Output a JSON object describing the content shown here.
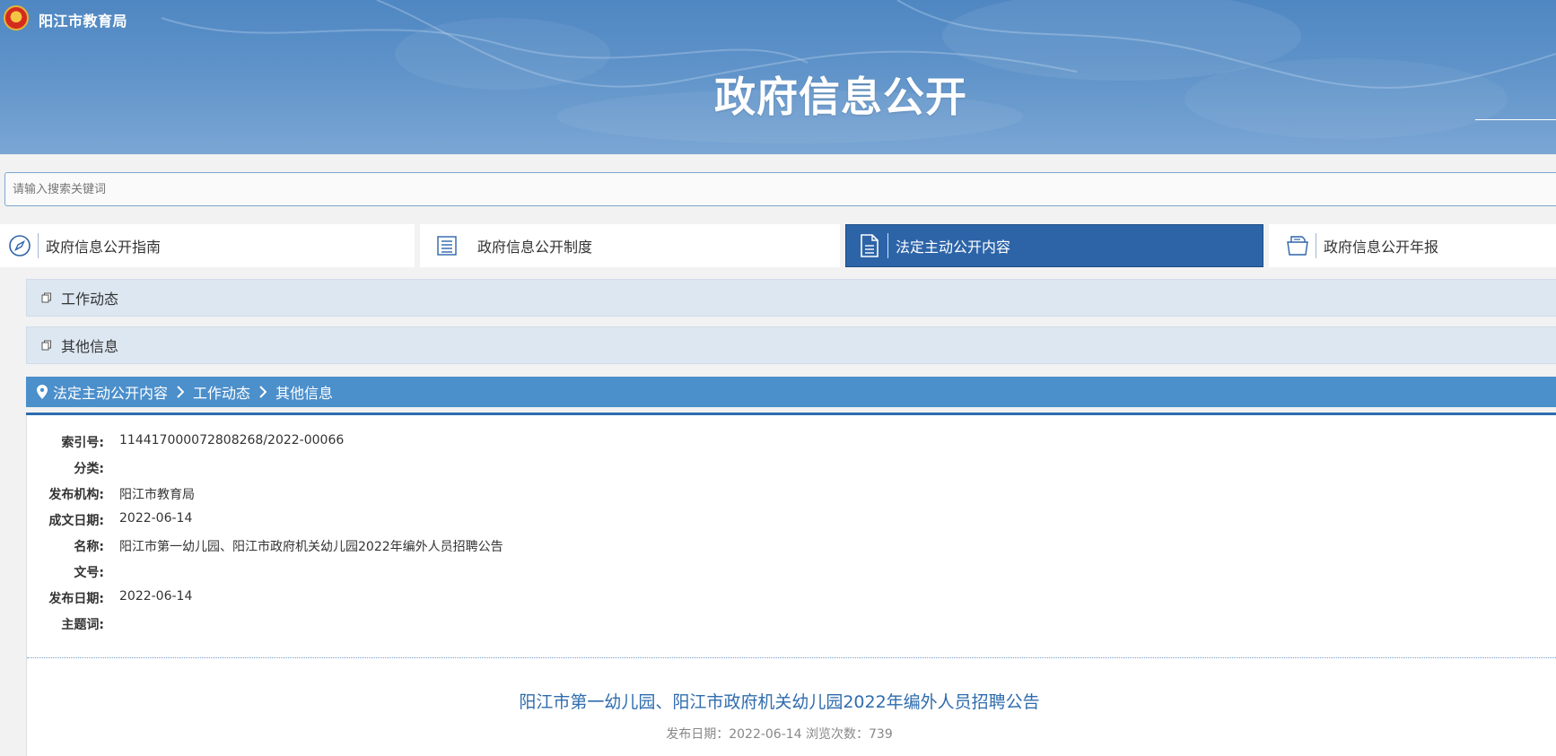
{
  "header": {
    "site_name": "阳江市教育局",
    "page_title": "政府信息公开"
  },
  "search": {
    "placeholder": "请输入搜索关键词"
  },
  "tabs": [
    {
      "label": "政府信息公开指南",
      "icon": "compass-icon",
      "active": false
    },
    {
      "label": "政府信息公开制度",
      "icon": "list-icon",
      "active": false
    },
    {
      "label": "法定主动公开内容",
      "icon": "document-icon",
      "active": true
    },
    {
      "label": "政府信息公开年报",
      "icon": "folder-icon",
      "active": false
    }
  ],
  "categories": [
    {
      "label": "工作动态",
      "icon": "copy-doc-icon"
    },
    {
      "label": "其他信息",
      "icon": "copy-doc-icon"
    }
  ],
  "breadcrumb": {
    "icon": "location-pin-icon",
    "items": [
      "法定主动公开内容",
      "工作动态",
      "其他信息"
    ]
  },
  "meta": [
    {
      "label": "索引号:",
      "value": "114417000072808268/2022-00066"
    },
    {
      "label": "分类:",
      "value": ""
    },
    {
      "label": "发布机构:",
      "value": "阳江市教育局"
    },
    {
      "label": "成文日期:",
      "value": "2022-06-14"
    },
    {
      "label": "名称:",
      "value": "阳江市第一幼儿园、阳江市政府机关幼儿园2022年编外人员招聘公告"
    },
    {
      "label": "文号:",
      "value": ""
    },
    {
      "label": "发布日期:",
      "value": "2022-06-14"
    },
    {
      "label": "主题词:",
      "value": ""
    }
  ],
  "article": {
    "title": "阳江市第一幼儿园、阳江市政府机关幼儿园2022年编外人员招聘公告",
    "info": "发布日期：2022-06-14  浏览次数：739"
  },
  "colors": {
    "banner": "#5f93c9",
    "active_tab": "#2d64a8",
    "crumb_bar": "#4b8fcb",
    "category_bg": "#dde7f1",
    "article_title": "#2f6cae"
  }
}
